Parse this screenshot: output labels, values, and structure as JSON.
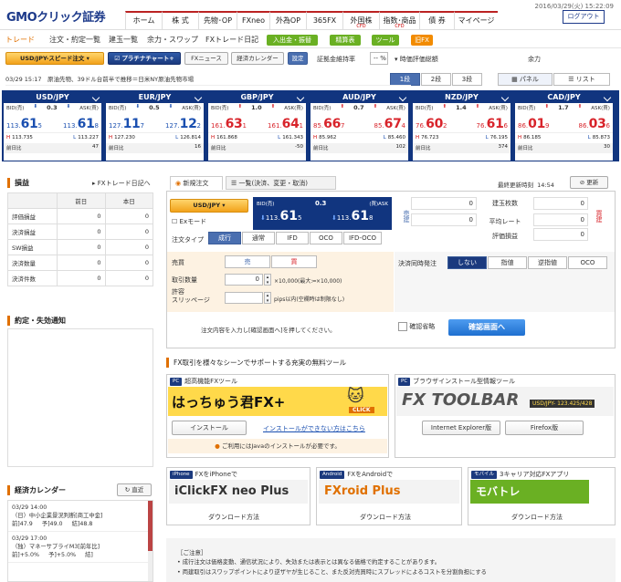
{
  "header": {
    "logo": "GMOクリック証券",
    "datetime": "2016/03/29(火) 15:22:09",
    "logout": "ログアウト",
    "nav": [
      {
        "label": "ホーム",
        "sub": ""
      },
      {
        "label": "株 式",
        "sub": ""
      },
      {
        "label": "先物･OP",
        "sub": ""
      },
      {
        "label": "FXneo",
        "sub": ""
      },
      {
        "label": "外為OP",
        "sub": ""
      },
      {
        "label": "365FX",
        "sub": ""
      },
      {
        "label": "外国株",
        "sub": "CFD"
      },
      {
        "label": "指数･商品",
        "sub": "CFD"
      },
      {
        "label": "債 券",
        "sub": ""
      },
      {
        "label": "マイページ",
        "sub": ""
      }
    ]
  },
  "subnav": {
    "items": [
      "トレード",
      "注文・約定一覧",
      "建玉一覧",
      "余力・スワップ",
      "FXトレード日記"
    ],
    "deposit": "入出金・振替",
    "settlement": "精算表",
    "tools": "ツール",
    "old": "旧FX"
  },
  "toolbar": {
    "speed_order": "USD/JPY-スピード注文",
    "platinum": "プラチナチャート+",
    "fx_news": "FXニュース",
    "calendar": "経済カレンダー",
    "settings": "設定",
    "margin_label": "証拠金維持率",
    "margin_value": "-- %",
    "valuation_label": "時価評価総額",
    "power_label": "余力",
    "rows_1": "1段",
    "rows_2": "2段",
    "rows_3": "3段",
    "panel": "パネル",
    "list": "リスト"
  },
  "news": "03/29 15:17　原油先物、39ドル台前半で推移＝日米NY原油先物市場",
  "rates": [
    {
      "pair": "USD/JPY",
      "spread": "0.3",
      "bid_pre": "113.",
      "bid_big": "61",
      "bid_last": "5",
      "ask_pre": "113.",
      "ask_big": "61",
      "ask_last": "8",
      "high": "113.735",
      "low": "113.227",
      "diff": "47",
      "bid_dir": "down",
      "ask_dir": "down"
    },
    {
      "pair": "EUR/JPY",
      "spread": "0.5",
      "bid_pre": "127.",
      "bid_big": "11",
      "bid_last": "7",
      "ask_pre": "127.",
      "ask_big": "12",
      "ask_last": "2",
      "high": "127.230",
      "low": "126.814",
      "diff": "16",
      "bid_dir": "down",
      "ask_dir": "down"
    },
    {
      "pair": "GBP/JPY",
      "spread": "1.0",
      "bid_pre": "161.",
      "bid_big": "63",
      "bid_last": "1",
      "ask_pre": "161.",
      "ask_big": "64",
      "ask_last": "1",
      "high": "161.868",
      "low": "161.343",
      "diff": "-50",
      "bid_dir": "up",
      "ask_dir": "up"
    },
    {
      "pair": "AUD/JPY",
      "spread": "0.7",
      "bid_pre": "85.",
      "bid_big": "66",
      "bid_last": "7",
      "ask_pre": "85.",
      "ask_big": "67",
      "ask_last": "4",
      "high": "85.962",
      "low": "85.460",
      "diff": "102",
      "bid_dir": "up",
      "ask_dir": "up"
    },
    {
      "pair": "NZD/JPY",
      "spread": "1.4",
      "bid_pre": "76.",
      "bid_big": "60",
      "bid_last": "2",
      "ask_pre": "76.",
      "ask_big": "61",
      "ask_last": "6",
      "high": "76.723",
      "low": "76.195",
      "diff": "374",
      "bid_dir": "up",
      "ask_dir": "up"
    },
    {
      "pair": "CAD/JPY",
      "spread": "1.7",
      "bid_pre": "86.",
      "bid_big": "01",
      "bid_last": "9",
      "ask_pre": "86.",
      "ask_big": "03",
      "ask_last": "6",
      "high": "86.185",
      "low": "85.873",
      "diff": "30",
      "bid_dir": "up",
      "ask_dir": "up"
    }
  ],
  "rate_labels": {
    "bid": "BID(売)",
    "ask": "ASK(買)",
    "high": "H",
    "low": "L",
    "prev": "前日比"
  },
  "pnl": {
    "title": "損益",
    "diary_link": "FXトレード日記へ",
    "col_prev": "前日",
    "col_today": "本日",
    "rows": [
      {
        "label": "評価損益",
        "prev": "0",
        "today": "0"
      },
      {
        "label": "決済損益",
        "prev": "0",
        "today": "0"
      },
      {
        "label": "SW損益",
        "prev": "0",
        "today": "0"
      },
      {
        "label": "決済数量",
        "prev": "0",
        "today": "0"
      },
      {
        "label": "決済件数",
        "prev": "0",
        "today": "0"
      }
    ]
  },
  "notices": {
    "title": "約定・失効通知"
  },
  "calendar": {
    "title": "経済カレンダー",
    "latest": "直近",
    "events": [
      {
        "time": "03/29 14:00",
        "name": "（日）中小企業景況判断[商工中金]",
        "prev": "前]47.9",
        "fore": "予]49.0",
        "res": "結]48.8"
      },
      {
        "time": "03/29 17:00",
        "name": "（独）マネーサプライM3[前年比]",
        "prev": "前]+5.0%",
        "fore": "予]+5.0%",
        "res": "結]"
      }
    ]
  },
  "order": {
    "tab_new": "新規注文",
    "tab_list": "一覧(決済、変更・取消)",
    "last_update_label": "最終更新時刻",
    "last_update": "14:54",
    "refresh": "更新",
    "pair": "USD/JPY",
    "ex_mode": "Exモード",
    "bid_label": "BID(売)",
    "ask_label": "(買)ASK",
    "spread": "0.3",
    "bid_pre": "113.",
    "bid_big": "61",
    "bid_last": "5",
    "ask_pre": "113.",
    "ask_big": "61",
    "ask_last": "8",
    "sell_side": "売建",
    "buy_side": "買建",
    "sell_qty": "0",
    "buy_qty": "0",
    "pos_count_label": "建玉枚数",
    "avg_rate_label": "平均レート",
    "valuation_label": "評価損益",
    "pos_count": "0",
    "avg_rate": "0",
    "valuation": "0",
    "type_label": "注文タイプ",
    "types": [
      "成行",
      "通常",
      "IFD",
      "OCO",
      "IFD-OCO"
    ],
    "side_label": "売買",
    "sell": "売",
    "buy": "買",
    "qty_label": "取引数量",
    "qty_value": "0",
    "qty_note": "×10,000(最大:━×10,000)",
    "slip_label": "許容スリッページ",
    "slip_note": "pips以内(空欄時は制限なし)",
    "settle_label": "決済同時発注",
    "settle_opts": [
      "しない",
      "指値",
      "逆指値",
      "OCO"
    ],
    "hint": "注文内容を入力し[確認画面へ]を押してください。",
    "skip": "確認省略",
    "confirm": "確認画面へ"
  },
  "tools": {
    "heading": "FX取引を様々なシーンでサポートする充実の無料ツール",
    "pc1_tag": "PC",
    "pc1_title": "超高機能FXツール",
    "pc1_banner": "はっちゅう君FX+",
    "pc1_click": "CLICK",
    "install": "インストール",
    "cant_install": "インストールができない方はこちら",
    "java_note": "ご利用にはJavaのインストールが必要です。",
    "pc2_tag": "PC",
    "pc2_title": "ブラウザインストール型情報ツール",
    "pc2_banner": "FX TOOLBAR",
    "pc2_rate": "USD/JPY- 123.425/428",
    "ie": "Internet Explorer版",
    "firefox": "Firefox版",
    "iphone_tag": "iPhone",
    "iphone_title": "FXをiPhoneで",
    "iphone_banner": "iClickFX neo Plus",
    "android_tag": "Android",
    "android_title": "FXをAndroidで",
    "android_banner": "FXroid Plus",
    "mobile_tag": "モバイル",
    "mobile_title": "3キャリア対応FXアプリ",
    "mobile_banner": "モバトレ",
    "download": "ダウンロード方法"
  },
  "notes": {
    "title": "［ご注意］",
    "lines": [
      "成行注文は価格変動、通信状況により、失効または表示とは異なる価格で約定することがあります。",
      "両建取引はスワップポイントにより逆ザヤが生じること、また反対売買時にスプレッドによるコストを分割負担にする"
    ]
  },
  "colors": {
    "navy": "#11357f",
    "orange": "#f28b00",
    "green": "#6ab023",
    "red": "#d8242b",
    "blue": "#1a4fb0"
  }
}
